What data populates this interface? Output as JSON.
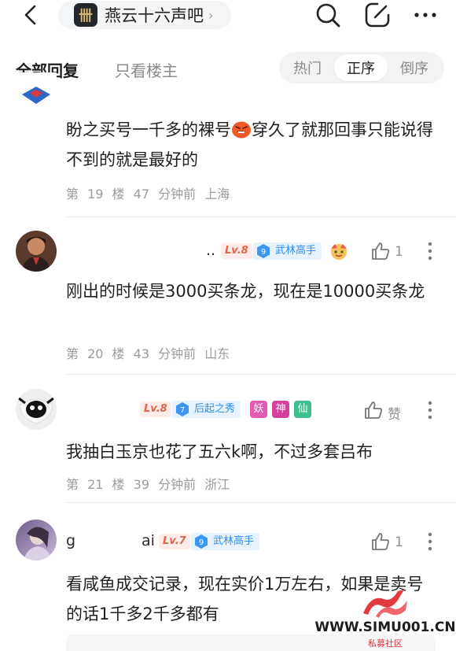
{
  "nav": {
    "forum_name": "燕云十六声吧",
    "forum_logo_glyph": "卌"
  },
  "sort": {
    "all_replies": "全部回复",
    "op_only": "只看楼主",
    "options": [
      "热门",
      "正序",
      "倒序"
    ],
    "active": "正序"
  },
  "posts": [
    {
      "content_before": "盼之买号一千多的裸号",
      "content_after": "穿久了就那回事只能说得不到的就是最好的",
      "floor": "第 19 楼",
      "time": "47 分钟前",
      "location": "上海"
    },
    {
      "username": "",
      "username_tail": "..",
      "level": "Lv.8",
      "title_level": "9",
      "title": "武林高手",
      "likes": "1",
      "content": "刚出的时候是3000买条龙，现在是10000买条龙",
      "floor": "第 20 楼",
      "time": "43 分钟前",
      "location": "山东"
    },
    {
      "username": "",
      "level": "Lv.8",
      "title_level": "7",
      "title": "后起之秀",
      "badges": [
        "妖",
        "神",
        "仙"
      ],
      "likes": "赞",
      "content": "我抽白玉京也花了五六k啊，不过多套吕布",
      "floor": "第 21 楼",
      "time": "39 分钟前",
      "location": "浙江"
    },
    {
      "username": "g",
      "username_tail": "ai",
      "level": "Lv.7",
      "title_level": "9",
      "title": "武林高手",
      "likes": "1",
      "content": "看咸鱼成交记录，现在实价1万左右，如果是卖号的话1千多2千多都有"
    }
  ],
  "watermark": {
    "site": "WWW.SIMU001.CN",
    "label": "私募社区"
  },
  "colors": {
    "level_badge": "#e0654c",
    "title_badge": "#2f8ef0",
    "badge_yao": "#e45bb4",
    "badge_shen": "#d4409c",
    "badge_xian": "#3fbf8e"
  }
}
